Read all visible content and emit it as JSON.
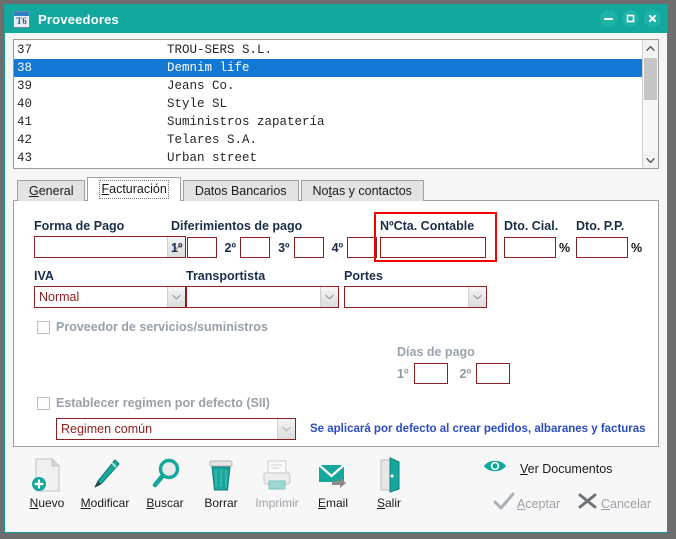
{
  "window": {
    "title": "Proveedores",
    "app_icon": "T6",
    "controls": [
      {
        "name": "minimize-button",
        "glyph": "minimize-icon"
      },
      {
        "name": "maximize-button",
        "glyph": "maximize-icon"
      },
      {
        "name": "close-button",
        "glyph": "close-icon"
      }
    ]
  },
  "list": {
    "rows": [
      {
        "id": "37",
        "name": "TROU-SERS S.L.",
        "selected": false
      },
      {
        "id": "38",
        "name": "Demnim life",
        "selected": true
      },
      {
        "id": "39",
        "name": "Jeans Co.",
        "selected": false
      },
      {
        "id": "40",
        "name": "Style SL",
        "selected": false
      },
      {
        "id": "41",
        "name": "Suministros zapatería",
        "selected": false
      },
      {
        "id": "42",
        "name": "Telares S.A.",
        "selected": false
      },
      {
        "id": "43",
        "name": "Urban street",
        "selected": false
      }
    ],
    "selected_color": "#1377d4"
  },
  "tabs": [
    {
      "label": "General",
      "mnemonic": "G",
      "active": false
    },
    {
      "label": "Facturación",
      "mnemonic": "F",
      "active": true
    },
    {
      "label": "Datos Bancarios",
      "mnemonic": "",
      "active": false
    },
    {
      "label": "Notas y contactos",
      "mnemonic": "t",
      "active": false
    }
  ],
  "form": {
    "forma_de_pago": {
      "label": "Forma de Pago",
      "value": ""
    },
    "diferimientos": {
      "label": "Diferimientos de pago",
      "items": [
        {
          "ord": "1º",
          "value": ""
        },
        {
          "ord": "2º",
          "value": ""
        },
        {
          "ord": "3º",
          "value": ""
        },
        {
          "ord": "4º",
          "value": ""
        }
      ]
    },
    "cuenta_contable": {
      "label": "NºCta. Contable",
      "value": "",
      "highlight_color": "#f50000"
    },
    "dto_cial": {
      "label": "Dto. Cial.",
      "value": "",
      "suffix": "%"
    },
    "dto_pp": {
      "label": "Dto. P.P.",
      "value": "",
      "suffix": "%"
    },
    "iva": {
      "label": "IVA",
      "value": "Normal"
    },
    "transportista": {
      "label": "Transportista",
      "value": ""
    },
    "portes": {
      "label": "Portes",
      "value": ""
    },
    "proveedor_servicios": {
      "label": "Proveedor de servicios/suministros",
      "checked": false
    },
    "dias_de_pago": {
      "label": "Días de pago",
      "items": [
        {
          "ord": "1º",
          "value": ""
        },
        {
          "ord": "2º",
          "value": ""
        }
      ]
    },
    "sii": {
      "label": "Establecer regimen por defecto (SII)",
      "checked": false,
      "regimen_value": "Regimen común",
      "hint": "Se aplicará por defecto al crear pedidos, albaranes y facturas"
    }
  },
  "toolbar": {
    "buttons": [
      {
        "label": "Nuevo",
        "mnemonic": "N",
        "icon": "new-document-icon",
        "disabled": false
      },
      {
        "label": "Modificar",
        "mnemonic": "M",
        "icon": "pen-icon",
        "disabled": false
      },
      {
        "label": "Buscar",
        "mnemonic": "B",
        "icon": "magnifier-icon",
        "disabled": false
      },
      {
        "label": "Borrar",
        "mnemonic": "",
        "icon": "trash-icon",
        "disabled": false
      },
      {
        "label": "Imprimir",
        "mnemonic": "",
        "icon": "printer-icon",
        "disabled": true
      },
      {
        "label": "Email",
        "mnemonic": "E",
        "icon": "envelope-icon",
        "disabled": false
      },
      {
        "label": "Salir",
        "mnemonic": "S",
        "icon": "exit-door-icon",
        "disabled": false
      }
    ],
    "ver_documentos": {
      "label": "Ver Documentos",
      "mnemonic": "V",
      "icon": "eye-icon"
    },
    "aceptar": {
      "label": "Aceptar",
      "mnemonic": "A",
      "icon": "check-icon",
      "disabled": true
    },
    "cancelar": {
      "label": "Cancelar",
      "mnemonic": "C",
      "icon": "cross-icon",
      "disabled": true
    }
  },
  "colors": {
    "titlebar": "#13a89e",
    "accent_teal": "#13a89e",
    "field_border": "#8c2020",
    "field_text": "#8c2020",
    "label_text": "#1a2e4a",
    "hint_text": "#2b4cc4"
  }
}
